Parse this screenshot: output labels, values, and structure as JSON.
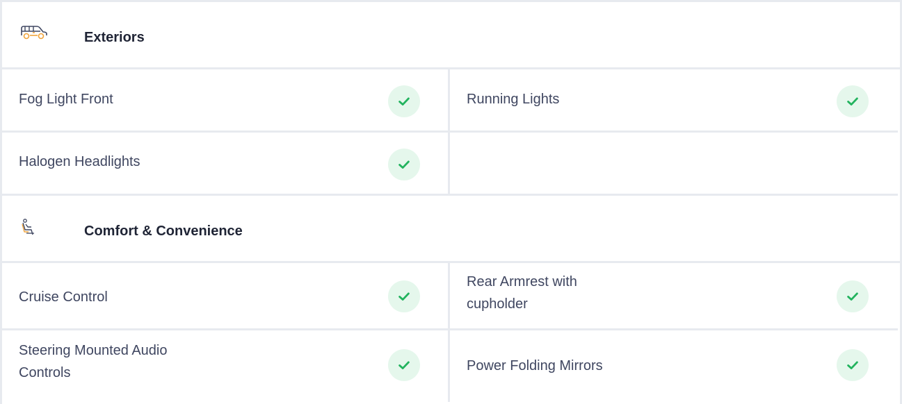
{
  "sections": [
    {
      "title": "Exteriors",
      "icon": "car-icon",
      "items": [
        {
          "label": "Fog Light Front",
          "available": true
        },
        {
          "label": "Running Lights",
          "available": true
        },
        {
          "label": "Halogen Headlights",
          "available": true
        }
      ]
    },
    {
      "title": "Comfort & Convenience",
      "icon": "seat-icon",
      "items": [
        {
          "label": "Cruise Control",
          "available": true
        },
        {
          "label": "Rear Armrest with cupholder",
          "available": true
        },
        {
          "label": "Steering Mounted Audio Controls",
          "available": true
        },
        {
          "label": "Power Folding Mirrors",
          "available": true
        }
      ]
    }
  ],
  "colors": {
    "border": "#e7eaef",
    "check_bg": "#e5f7ec",
    "check_mark": "#22b35e",
    "icon_accent": "#f0a33a"
  }
}
